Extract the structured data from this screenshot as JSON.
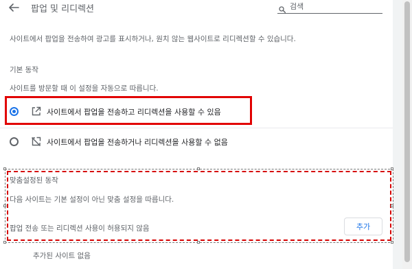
{
  "header": {
    "title": "팝업 및 리디렉션",
    "search_placeholder": "검색"
  },
  "description": "사이트에서 팝업을 전송하여 광고를 표시하거나, 원치 않는 웹사이트로 리디렉션할 수 있습니다.",
  "default_behavior": {
    "heading": "기본 동작",
    "subtitle": "사이트를 방문할 때 이 설정을 자동으로 따릅니다.",
    "options": [
      {
        "label": "사이트에서 팝업을 전송하고 리디렉션을 사용할 수 있음",
        "icon": "open-in-new-icon",
        "selected": true
      },
      {
        "label": "사이트에서 팝업을 전송하거나 리디렉션을 사용할 수 없음",
        "icon": "block-popup-icon",
        "selected": false
      }
    ]
  },
  "custom_behavior": {
    "heading": "맞춤설정된 동작",
    "subtitle": "다음 사이트는 기본 설정이 아닌 맞춤 설정을 따릅니다.",
    "list_label": "팝업 전송 또는 리디렉션 사용이 허용되지 않음",
    "add_button": "추가",
    "empty_text": "추가된 사이트 없음"
  },
  "colors": {
    "accent": "#1a73e8",
    "highlight": "#e10000"
  }
}
